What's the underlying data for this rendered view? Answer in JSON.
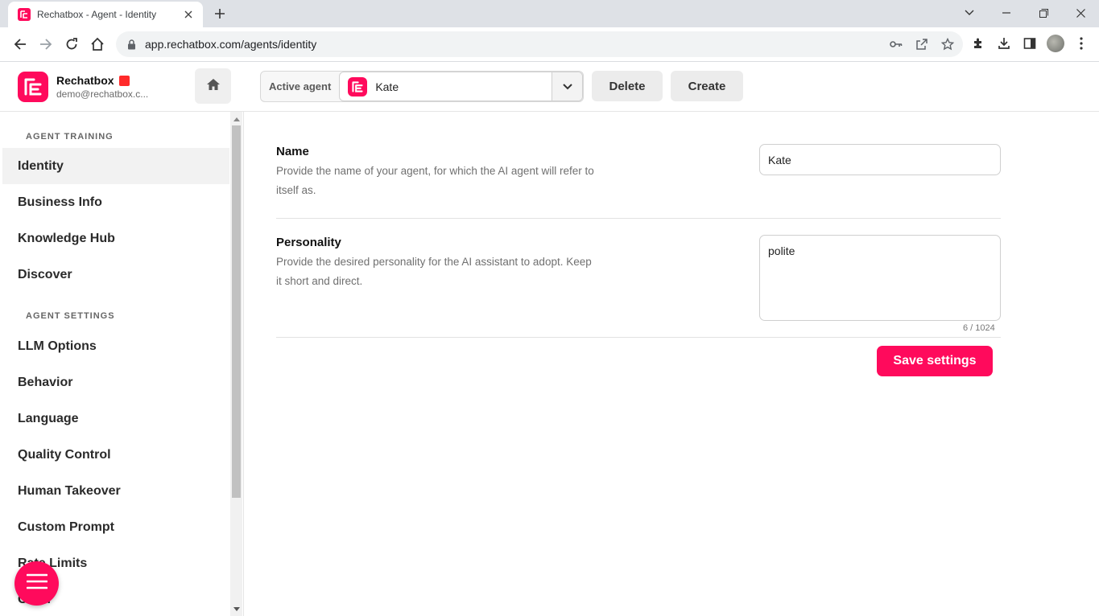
{
  "browser": {
    "tab_title": "Rechatbox - Agent - Identity",
    "url": "app.rechatbox.com/agents/identity"
  },
  "brand": {
    "name": "Rechatbox",
    "email": "demo@rechatbox.c...",
    "color": "#ff0a5c"
  },
  "header": {
    "active_agent_label": "Active agent",
    "active_agent_value": "Kate",
    "delete_label": "Delete",
    "create_label": "Create"
  },
  "sidebar": {
    "sections": [
      {
        "title": "AGENT TRAINING",
        "items": [
          "Identity",
          "Business Info",
          "Knowledge Hub",
          "Discover"
        ]
      },
      {
        "title": "AGENT SETTINGS",
        "items": [
          "LLM Options",
          "Behavior",
          "Language",
          "Quality Control",
          "Human Takeover",
          "Custom Prompt",
          "Rate Limits",
          "Other"
        ]
      }
    ],
    "active_item": "Identity"
  },
  "form": {
    "name": {
      "title": "Name",
      "description": "Provide the name of your agent, for which the AI agent will refer to itself as.",
      "value": "Kate"
    },
    "personality": {
      "title": "Personality",
      "description": "Provide the desired personality for the AI assistant to adopt. Keep it short and direct.",
      "value": "polite",
      "counter": "6 / 1024"
    },
    "save_label": "Save settings"
  },
  "icons": {
    "home": "home-icon",
    "menu": "hamburger-icon"
  }
}
